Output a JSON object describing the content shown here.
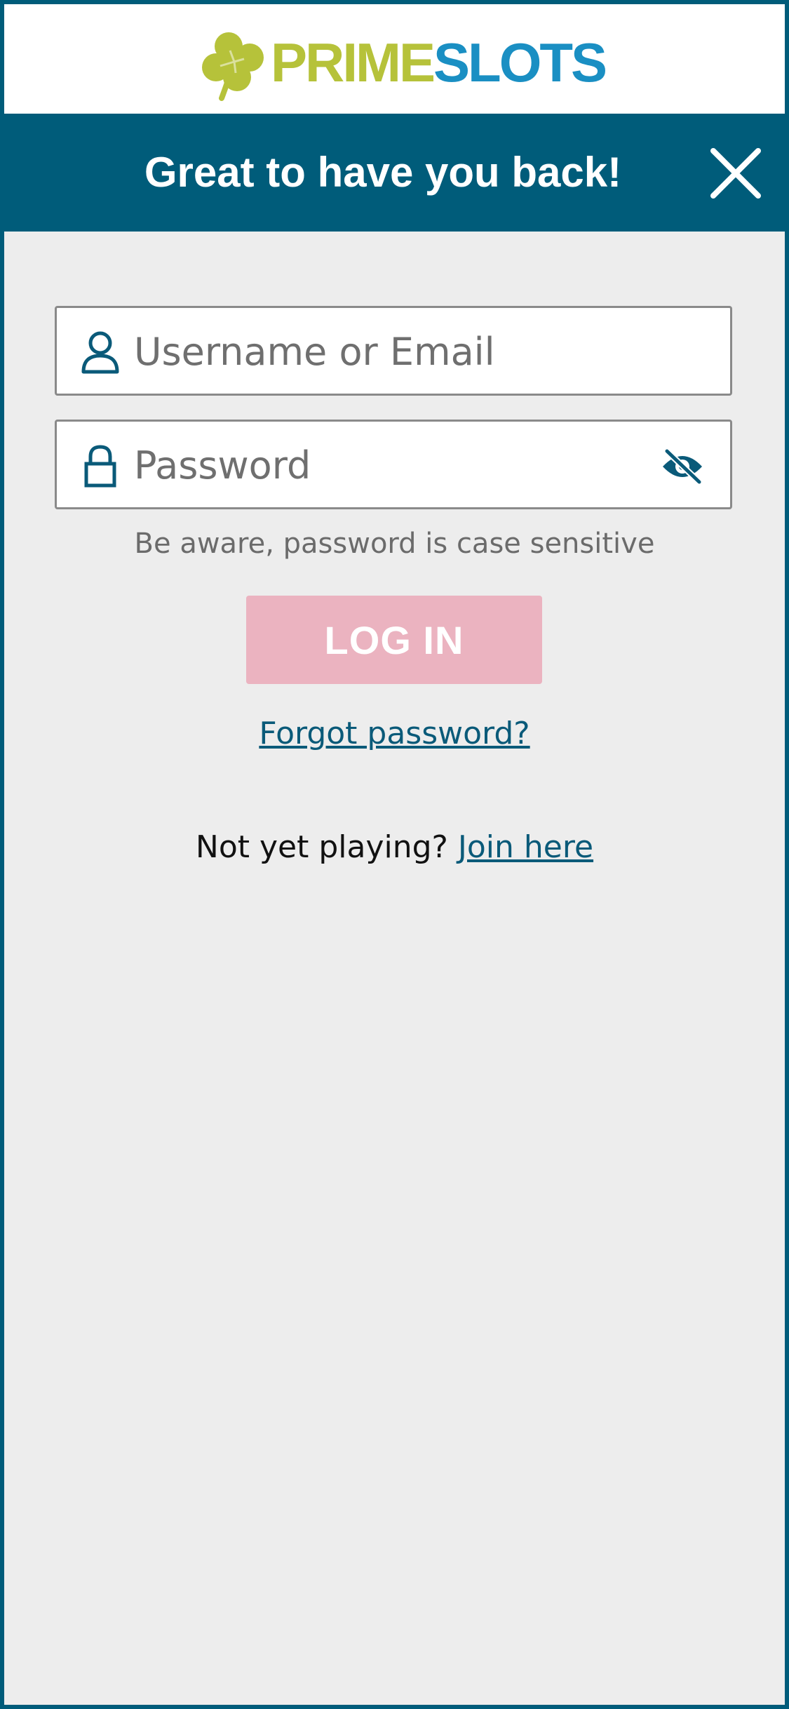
{
  "logo": {
    "prime": "PRIME",
    "slots": "SLOTS",
    "brand_green": "#b6c23a",
    "brand_blue": "#1a8fc3"
  },
  "banner": {
    "title": "Great to have you back!",
    "background": "#005c7a",
    "close_icon": "close-icon"
  },
  "form": {
    "username_placeholder": "Username or Email",
    "username_value": "",
    "username_icon": "user-icon",
    "password_placeholder": "Password",
    "password_value": "",
    "password_icon": "lock-icon",
    "toggle_icon": "eye-slash-icon",
    "hint": "Be aware, password is case sensitive",
    "login_label": "LOG IN",
    "login_color": "#ebb3c0",
    "forgot_label": "Forgot password?",
    "not_playing_text": "Not yet playing?",
    "join_label": "Join here"
  }
}
